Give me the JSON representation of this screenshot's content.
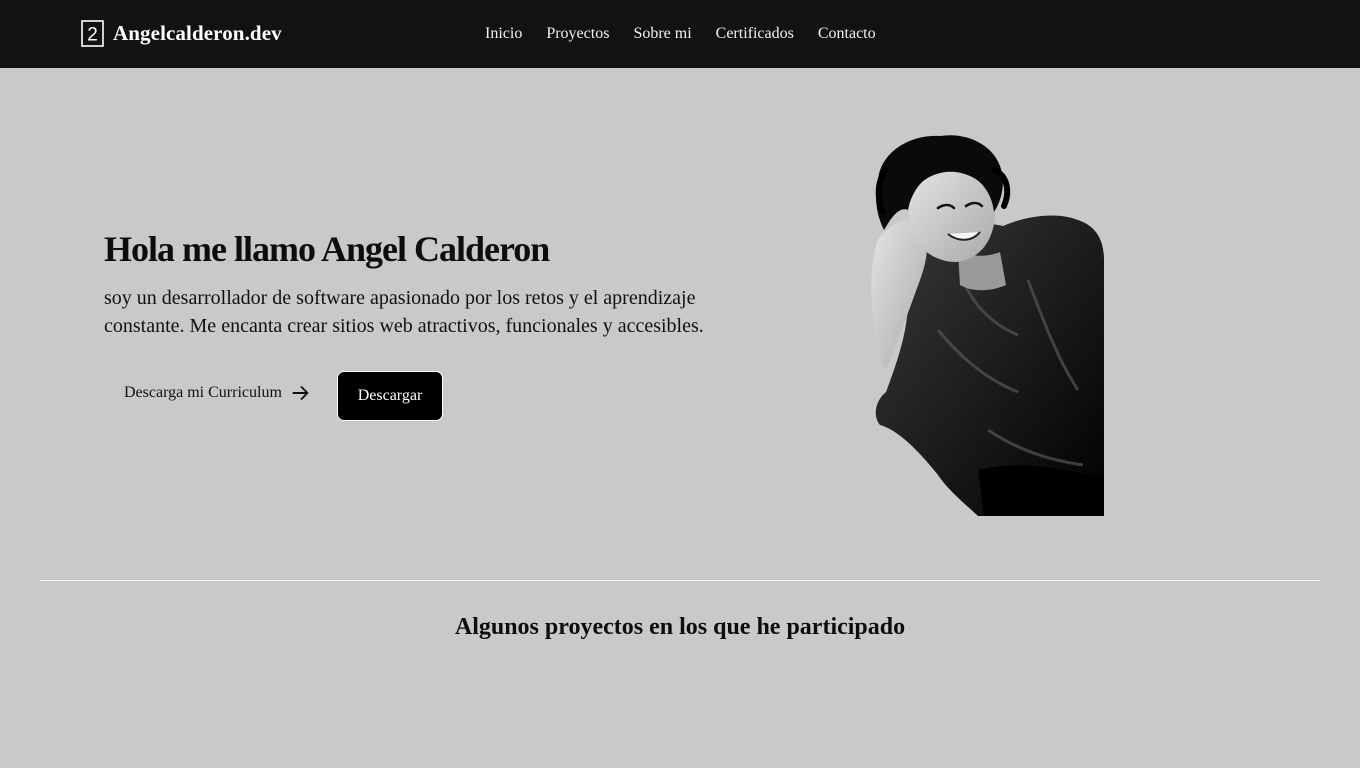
{
  "header": {
    "logo_glyph": "2",
    "brand": "Angelcalderon.dev",
    "nav": [
      "Inicio",
      "Proyectos",
      "Sobre mi",
      "Certificados",
      "Contacto"
    ]
  },
  "hero": {
    "title": "Hola me llamo Angel Calderon",
    "description": "soy un desarrollador de software apasionado por los retos y el aprendizaje constante. Me encanta crear sitios web atractivos, funcionales y accesibles.",
    "cv_link_label": "Descarga mi Curriculum",
    "download_button": "Descargar"
  },
  "projects": {
    "heading": "Algunos proyectos en los que he participado"
  },
  "colors": {
    "header_bg": "#121212",
    "page_bg": "#c9c9c9",
    "button_bg": "#000000",
    "text": "#0d0d0d"
  },
  "icons": {
    "brand": "number-two-logo-icon",
    "cv_link": "arrow-right-icon"
  }
}
